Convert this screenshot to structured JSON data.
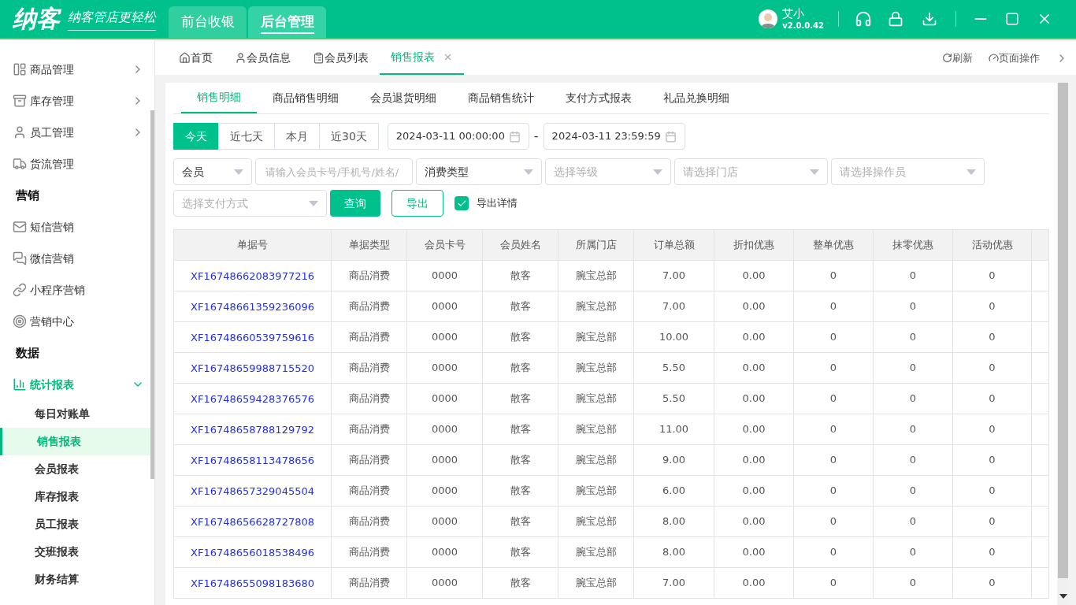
{
  "header": {
    "logo": "纳客",
    "slogan": "纳客管店更轻松",
    "modes": [
      {
        "label": "前台收银",
        "selected": false
      },
      {
        "label": "后台管理",
        "selected": true
      }
    ],
    "user": {
      "name": "艾小",
      "version": "v2.0.0.42"
    }
  },
  "sidebar": {
    "items": [
      {
        "kind": "item",
        "label": "商品管理",
        "expandable": true
      },
      {
        "kind": "item",
        "label": "库存管理",
        "expandable": true
      },
      {
        "kind": "item",
        "label": "员工管理",
        "expandable": true
      },
      {
        "kind": "item",
        "label": "货流管理",
        "expandable": false
      },
      {
        "kind": "section",
        "label": "营销"
      },
      {
        "kind": "item",
        "label": "短信营销",
        "expandable": false
      },
      {
        "kind": "item",
        "label": "微信营销",
        "expandable": false
      },
      {
        "kind": "item",
        "label": "小程序营销",
        "expandable": false
      },
      {
        "kind": "item",
        "label": "营销中心",
        "expandable": false
      },
      {
        "kind": "section",
        "label": "数据"
      },
      {
        "kind": "group",
        "label": "统计报表",
        "expanded": true,
        "children": [
          {
            "label": "每日对账单",
            "selected": false
          },
          {
            "label": "销售报表",
            "selected": true
          },
          {
            "label": "会员报表",
            "selected": false
          },
          {
            "label": "库存报表",
            "selected": false
          },
          {
            "label": "员工报表",
            "selected": false
          },
          {
            "label": "交班报表",
            "selected": false
          },
          {
            "label": "财务结算",
            "selected": false
          }
        ]
      }
    ]
  },
  "page_tabs": [
    {
      "label": "首页",
      "selected": false,
      "closable": false
    },
    {
      "label": "会员信息",
      "selected": false,
      "closable": false
    },
    {
      "label": "会员列表",
      "selected": false,
      "closable": false
    },
    {
      "label": "销售报表",
      "selected": true,
      "closable": true
    }
  ],
  "page_actions": [
    "刷新",
    "页面操作"
  ],
  "report_tabs": [
    {
      "label": "销售明细",
      "selected": true
    },
    {
      "label": "商品销售明细",
      "selected": false
    },
    {
      "label": "会员退货明细",
      "selected": false
    },
    {
      "label": "商品销售统计",
      "selected": false
    },
    {
      "label": "支付方式报表",
      "selected": false
    },
    {
      "label": "礼品兑换明细",
      "selected": false
    }
  ],
  "quick_ranges": [
    {
      "label": "今天",
      "selected": true
    },
    {
      "label": "近七天",
      "selected": false
    },
    {
      "label": "本月",
      "selected": false
    },
    {
      "label": "近30天",
      "selected": false
    }
  ],
  "date_from": "2024-03-11 00:00:00",
  "date_to": "2024-03-11 23:59:59",
  "date_separator": "-",
  "filters": {
    "member_type": "会员",
    "member_search": {
      "placeholder": "请输入会员卡号/手机号/姓名/"
    },
    "consume_type": "消费类型",
    "level": {
      "placeholder": "选择等级"
    },
    "store": {
      "placeholder": "请选择门店"
    },
    "operator": {
      "placeholder": "请选择操作员"
    },
    "payment": {
      "placeholder": "选择支付方式"
    }
  },
  "query_button": "查询",
  "export_button": "导出",
  "export_details": {
    "label": "导出详情",
    "checked": true
  },
  "table": {
    "columns": [
      "单据号",
      "单据类型",
      "会员卡号",
      "会员姓名",
      "所属门店",
      "订单总额",
      "折扣优惠",
      "整单优惠",
      "抹零优惠",
      "活动优惠"
    ],
    "rows": [
      [
        "XF16748662083977216",
        "商品消费",
        "0000",
        "散客",
        "腕宝总部",
        "7.00",
        "0.00",
        "0",
        "0",
        "0"
      ],
      [
        "XF16748661359236096",
        "商品消费",
        "0000",
        "散客",
        "腕宝总部",
        "7.00",
        "0.00",
        "0",
        "0",
        "0"
      ],
      [
        "XF16748660539759616",
        "商品消费",
        "0000",
        "散客",
        "腕宝总部",
        "10.00",
        "0.00",
        "0",
        "0",
        "0"
      ],
      [
        "XF16748659988715520",
        "商品消费",
        "0000",
        "散客",
        "腕宝总部",
        "5.50",
        "0.00",
        "0",
        "0",
        "0"
      ],
      [
        "XF16748659428376576",
        "商品消费",
        "0000",
        "散客",
        "腕宝总部",
        "5.50",
        "0.00",
        "0",
        "0",
        "0"
      ],
      [
        "XF16748658788129792",
        "商品消费",
        "0000",
        "散客",
        "腕宝总部",
        "11.00",
        "0.00",
        "0",
        "0",
        "0"
      ],
      [
        "XF16748658113478656",
        "商品消费",
        "0000",
        "散客",
        "腕宝总部",
        "9.00",
        "0.00",
        "0",
        "0",
        "0"
      ],
      [
        "XF16748657329045504",
        "商品消费",
        "0000",
        "散客",
        "腕宝总部",
        "6.00",
        "0.00",
        "0",
        "0",
        "0"
      ],
      [
        "XF16748656628727808",
        "商品消费",
        "0000",
        "散客",
        "腕宝总部",
        "8.00",
        "0.00",
        "0",
        "0",
        "0"
      ],
      [
        "XF16748656018538496",
        "商品消费",
        "0000",
        "散客",
        "腕宝总部",
        "8.00",
        "0.00",
        "0",
        "0",
        "0"
      ],
      [
        "XF16748655098183680",
        "商品消费",
        "0000",
        "散客",
        "腕宝总部",
        "7.00",
        "0.00",
        "0",
        "0",
        "0"
      ]
    ]
  }
}
